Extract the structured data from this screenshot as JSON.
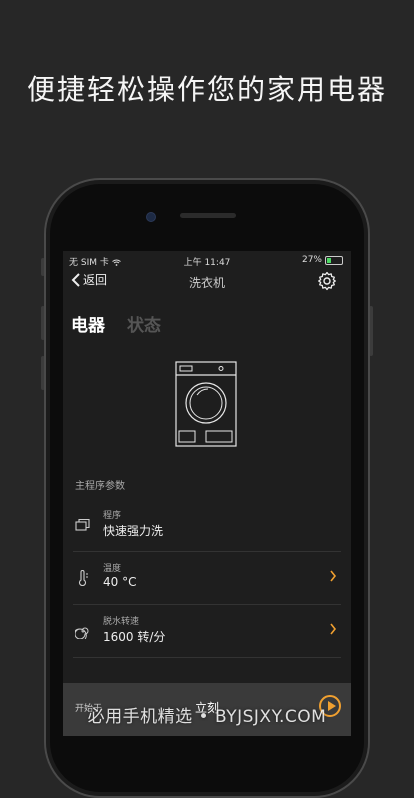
{
  "headline": "便捷轻松操作您的家用电器",
  "status_bar": {
    "carrier": "无 SIM 卡",
    "time": "上午 11:47",
    "battery": "27%"
  },
  "nav": {
    "back_label": "返回",
    "title": "洗衣机"
  },
  "tabs": [
    {
      "label": "电器",
      "active": true
    },
    {
      "label": "状态",
      "active": false
    }
  ],
  "section_title": "主程序参数",
  "rows": [
    {
      "label": "程序",
      "value": "快速强力洗",
      "icon": "program-icon"
    },
    {
      "label": "温度",
      "value": "40 °C",
      "icon": "thermometer-icon"
    },
    {
      "label": "脱水转速",
      "value": "1600 转/分",
      "icon": "spin-icon"
    }
  ],
  "bottom_bar": {
    "start_label": "开始于",
    "start_value": "立刻"
  },
  "watermark": "必用手机精选 • BYJSJXY.COM",
  "colors": {
    "accent": "#f0a030",
    "background": "#272727",
    "screen": "#1e1e1e"
  }
}
